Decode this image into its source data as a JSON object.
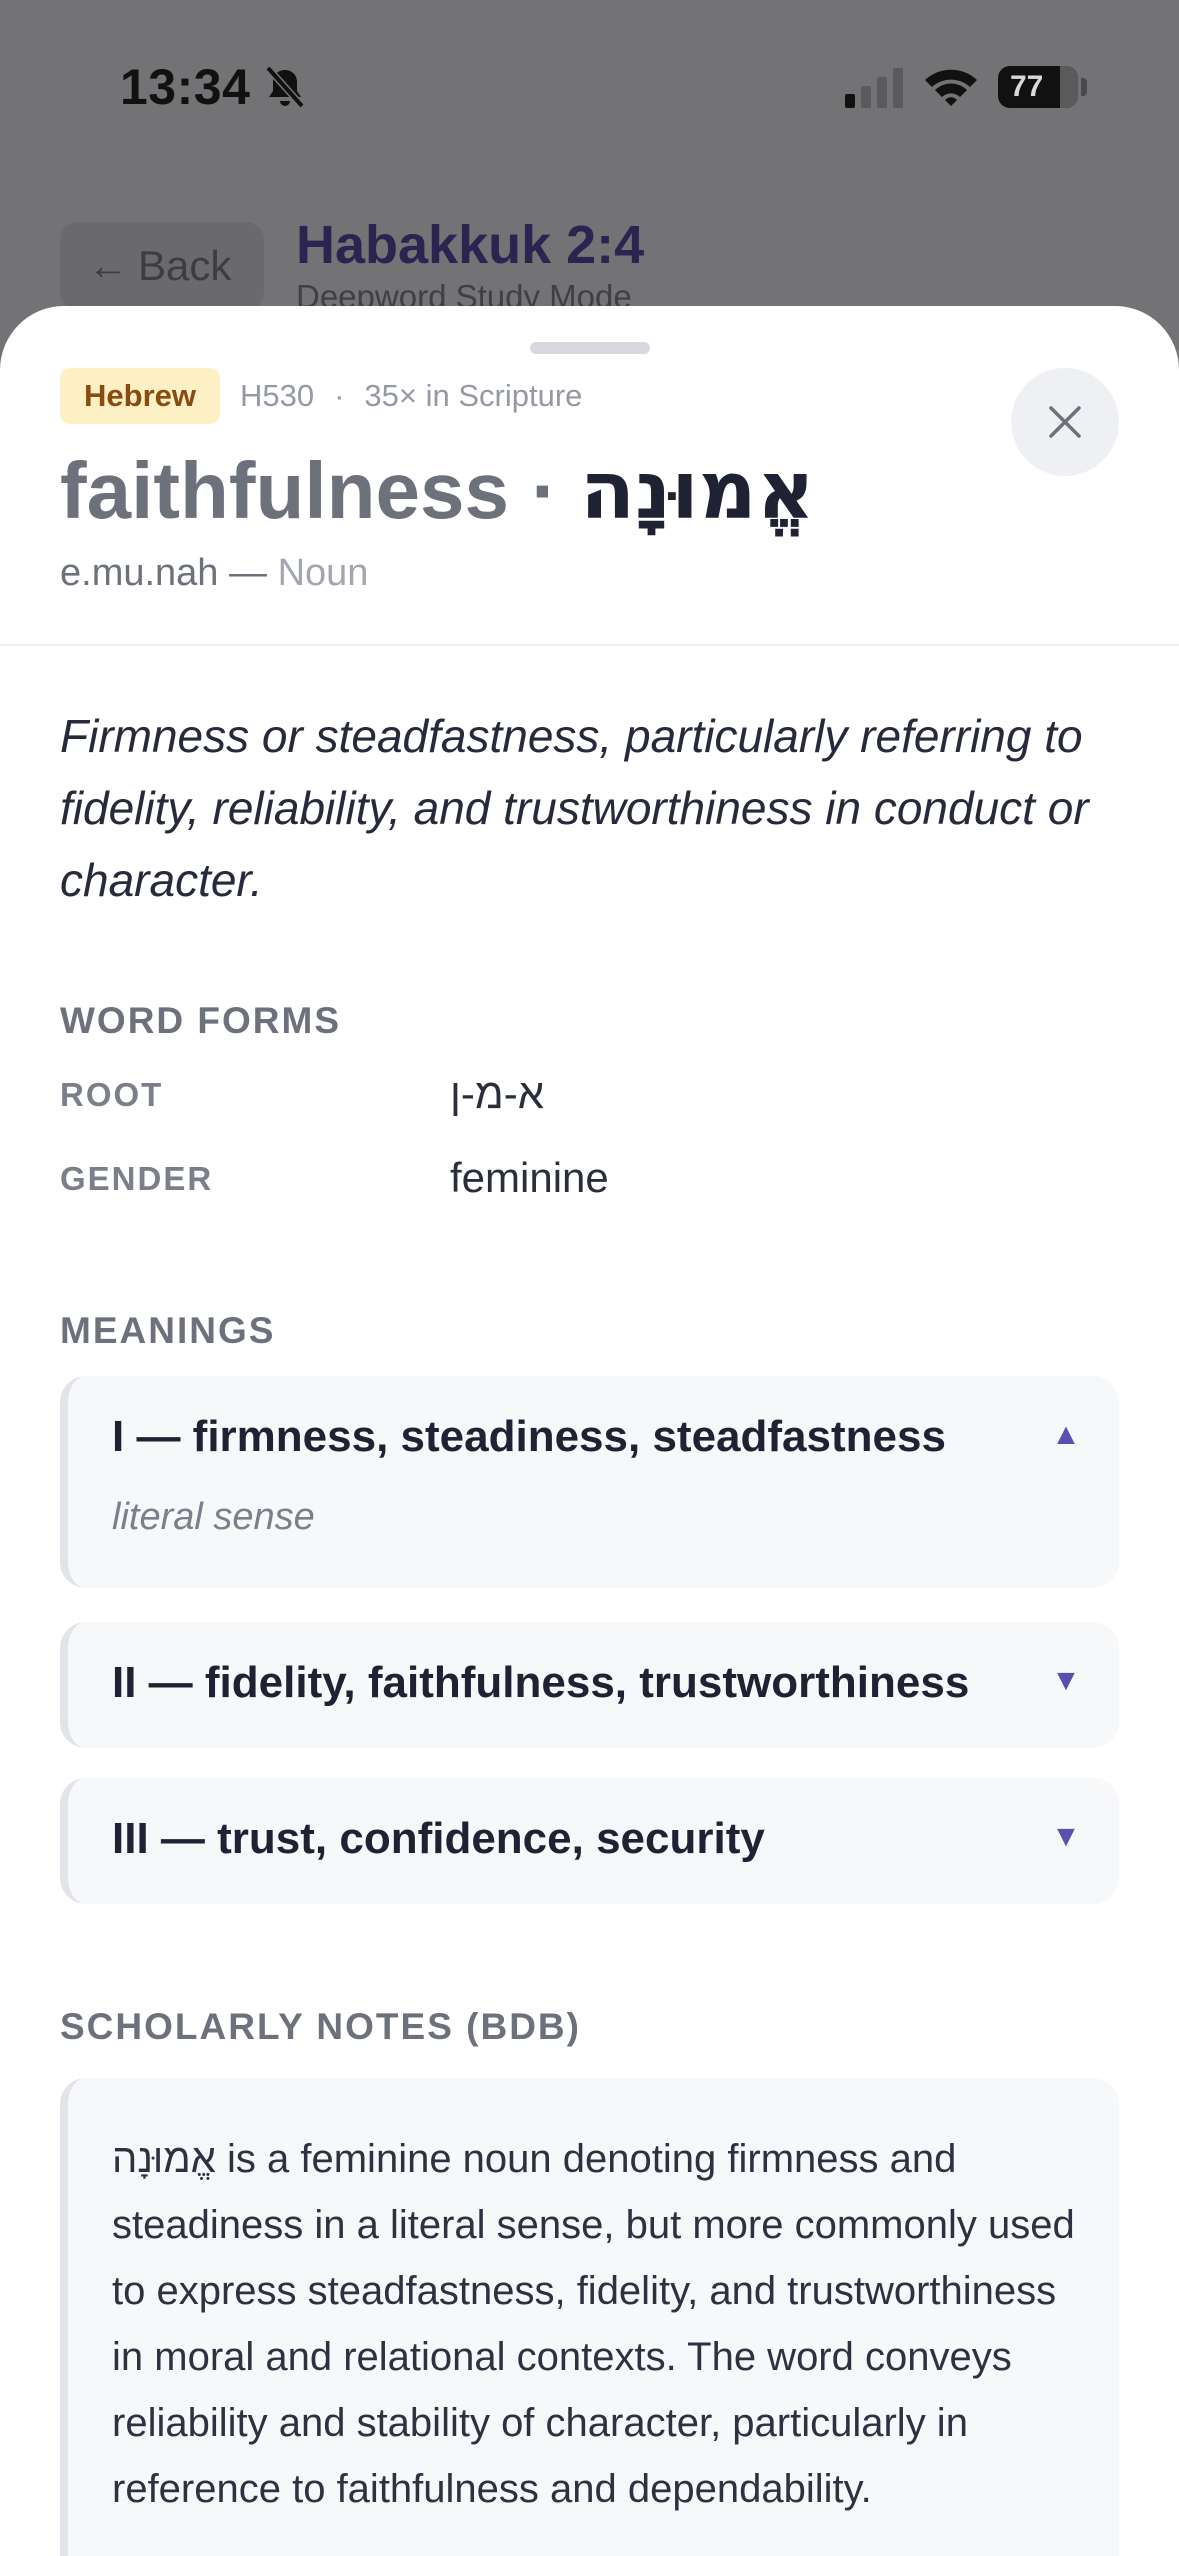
{
  "status_bar": {
    "time": "13:34",
    "battery": "77"
  },
  "background": {
    "back_label": "Back",
    "title": "Habakkuk 2:4",
    "subtitle": "Deepword Study Mode"
  },
  "entry": {
    "language": "Hebrew",
    "strongs": "H530",
    "meta_separator": "·",
    "occurrences": "35× in Scripture",
    "gloss": "faithfulness",
    "headword_separator": "·",
    "hebrew": "אֱמוּנָה",
    "transliteration": "e.mu.nah",
    "pos_separator": "—",
    "part_of_speech": "Noun",
    "definition": "Firmness or steadfastness, particularly referring to fidelity, reliability, and trustworthiness in conduct or character."
  },
  "word_forms": {
    "title": "WORD FORMS",
    "rows": [
      {
        "label": "ROOT",
        "value": "א-מ-ן"
      },
      {
        "label": "GENDER",
        "value": "feminine"
      }
    ]
  },
  "meanings": {
    "title": "MEANINGS",
    "items": [
      {
        "heading": "I — firmness, steadiness, steadfastness",
        "sub": "literal sense",
        "expanded": true,
        "toggle_icon": "▲"
      },
      {
        "heading": "II — fidelity, faithfulness, trustworthiness",
        "expanded": false,
        "toggle_icon": "▼"
      },
      {
        "heading": "III — trust, confidence, security",
        "expanded": false,
        "toggle_icon": "▼"
      }
    ]
  },
  "notes": {
    "title": "SCHOLARLY NOTES (BDB)",
    "text": "אֱמוּנָה is a feminine noun denoting firmness and steadiness in a literal sense, but more commonly used to express steadfastness, fidelity, and trustworthiness in moral and relational contexts. The word conveys reliability and stability of character, particularly in reference to faithfulness and dependability."
  },
  "colors": {
    "accent": "#5b4fb0",
    "badge_bg": "#fdf0c4",
    "badge_text": "#8a4b12",
    "sheet_bg": "#ffffff",
    "card_bg": "#f7f8fa"
  },
  "icons": {
    "close": "close-icon",
    "back": "arrow-left-icon",
    "silent": "bell-slash-icon",
    "signal": "cellular-signal-icon",
    "wifi": "wifi-icon",
    "battery": "battery-icon"
  }
}
